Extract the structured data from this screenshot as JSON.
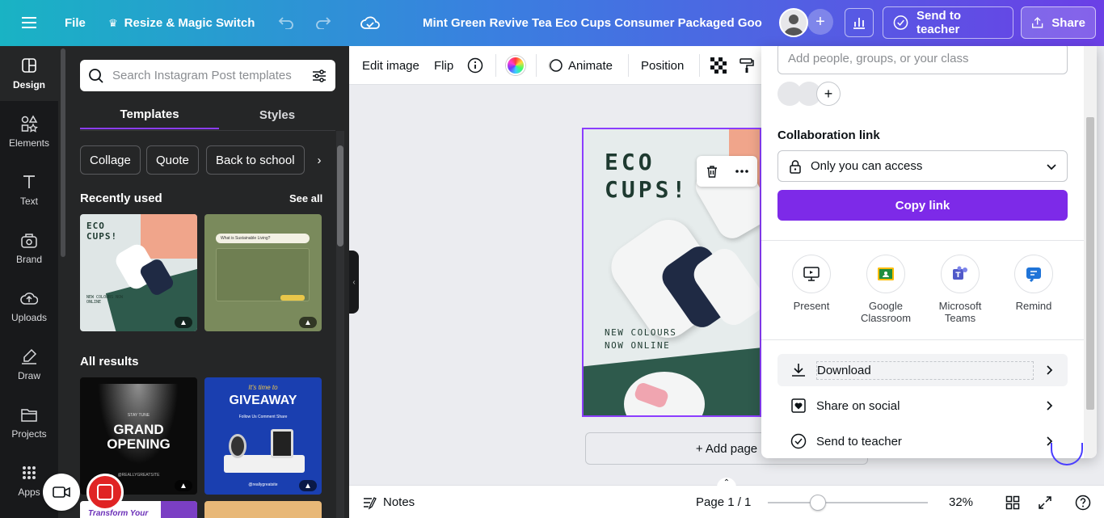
{
  "topbar": {
    "file_label": "File",
    "resize_label": "Resize & Magic Switch",
    "doc_title": "Mint Green Revive Tea Eco Cups Consumer Packaged Good...",
    "send_teacher_label": "Send to teacher",
    "share_label": "Share"
  },
  "rail": {
    "items": [
      {
        "label": "Design"
      },
      {
        "label": "Elements"
      },
      {
        "label": "Text"
      },
      {
        "label": "Brand"
      },
      {
        "label": "Uploads"
      },
      {
        "label": "Draw"
      },
      {
        "label": "Projects"
      },
      {
        "label": "Apps"
      }
    ]
  },
  "panel": {
    "search_placeholder": "Search Instagram Post templates",
    "tabs": [
      "Templates",
      "Styles"
    ],
    "chips": [
      "Collage",
      "Quote",
      "Back to school"
    ],
    "recently_used": "Recently used",
    "see_all": "See all",
    "all_results": "All results",
    "thumbs": {
      "t1_title": "ECO CUPS!",
      "t1_sub": "NEW COLOURS NOW ONLINE",
      "t2_title": "What is Sustainable Living?",
      "t3_kicker": "STAY TUNE",
      "t3_title1": "GRAND",
      "t3_title2": "OPENING",
      "t3_site": "@REALLYGREATSITE",
      "t4_kicker": "It's time to",
      "t4_title": "GIVEAWAY",
      "t4_steps": "Follow Us  Comment  Share",
      "t4_site": "@reallygreatsite",
      "t5_title": "Transform Your"
    }
  },
  "context_toolbar": {
    "edit_image": "Edit image",
    "flip": "Flip",
    "animate": "Animate",
    "position": "Position"
  },
  "canvas": {
    "title_line1": "ECO",
    "title_line2": "CUPS!",
    "sub_line1": "NEW COLOURS",
    "sub_line2": "NOW ONLINE",
    "add_page": "+ Add page"
  },
  "share_panel": {
    "people_placeholder": "Add people, groups, or your class",
    "collab_label": "Collaboration link",
    "access_value": "Only you can access",
    "copy_link": "Copy link",
    "apps": [
      {
        "label": "Present"
      },
      {
        "label": "Google Classroom"
      },
      {
        "label": "Microsoft Teams"
      },
      {
        "label": "Remind"
      }
    ],
    "rows": [
      {
        "label": "Download"
      },
      {
        "label": "Share on social"
      },
      {
        "label": "Send to teacher"
      }
    ]
  },
  "bottombar": {
    "notes": "Notes",
    "page": "Page 1 / 1",
    "zoom": "32%",
    "zoom_level": 32
  },
  "colors": {
    "accent": "#8b3dff",
    "copy_button": "#7d2ae8",
    "rail_bg": "#18191b",
    "panel_bg": "#252627",
    "record_red": "#e02424"
  }
}
